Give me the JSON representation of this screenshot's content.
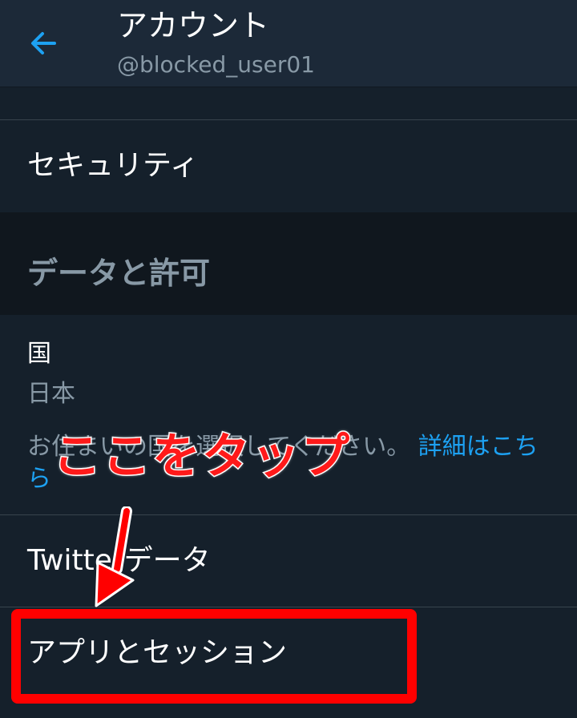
{
  "header": {
    "title": "アカウント",
    "username": "@blocked_user01"
  },
  "rows": {
    "security": "セキュリティ",
    "data_permissions_section": "データと許可",
    "country_title": "国",
    "country_value": "日本",
    "country_desc_text": "お住まいの国を選択してください。",
    "country_desc_link": "詳細はこちら",
    "twitter_data": "Twitterデータ",
    "apps_sessions": "アプリとセッション"
  },
  "annotation": {
    "callout": "ここをタップ",
    "color": "#ff0000"
  },
  "colors": {
    "background": "#15202b",
    "header_bg": "#1c2938",
    "accent": "#1da1f2",
    "secondary_text": "#8899a6"
  }
}
